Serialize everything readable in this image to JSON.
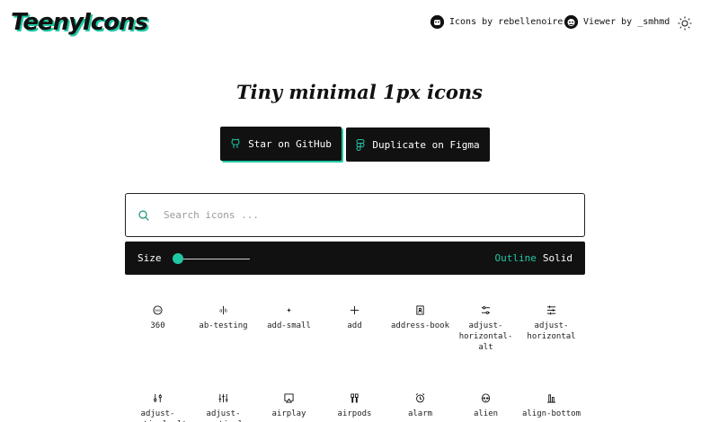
{
  "header": {
    "logo": "TeenyIcons",
    "credits": [
      {
        "label": "Icons by rebellenoire",
        "avatar": "avatar-rebellenoire"
      },
      {
        "label": "Viewer by _smhmd",
        "avatar": "avatar-smhmd"
      }
    ],
    "theme_icon": "sun-icon"
  },
  "hero": {
    "tagline": "Tiny minimal 1px icons",
    "github_button": "Star on GitHub",
    "figma_button": "Duplicate on Figma"
  },
  "search": {
    "placeholder": "Search icons ...",
    "value": ""
  },
  "toolbar": {
    "size_label": "Size",
    "size_value": 0,
    "outline_label": "Outline",
    "solid_label": "Solid",
    "selected_style": "Outline"
  },
  "icons": [
    {
      "name": "360",
      "label": "360"
    },
    {
      "name": "ab-testing",
      "label": "ab-testing"
    },
    {
      "name": "add-small",
      "label": "add-small"
    },
    {
      "name": "add",
      "label": "add"
    },
    {
      "name": "address-book",
      "label": "address-book"
    },
    {
      "name": "adjust-horizontal-alt",
      "label": "adjust-\nhorizontal-\nalt"
    },
    {
      "name": "adjust-horizontal",
      "label": "adjust-\nhorizontal"
    },
    {
      "name": "adjust-vertical-alt",
      "label": "adjust-\nvertical-alt"
    },
    {
      "name": "adjust-vertical",
      "label": "adjust-\nvertical"
    },
    {
      "name": "airplay",
      "label": "airplay"
    },
    {
      "name": "airpods",
      "label": "airpods"
    },
    {
      "name": "alarm",
      "label": "alarm"
    },
    {
      "name": "alien",
      "label": "alien"
    },
    {
      "name": "align-bottom",
      "label": "align-bottom"
    }
  ],
  "colors": {
    "accent": "#1ec8a5",
    "dark": "#111111",
    "background": "#ffffff"
  }
}
